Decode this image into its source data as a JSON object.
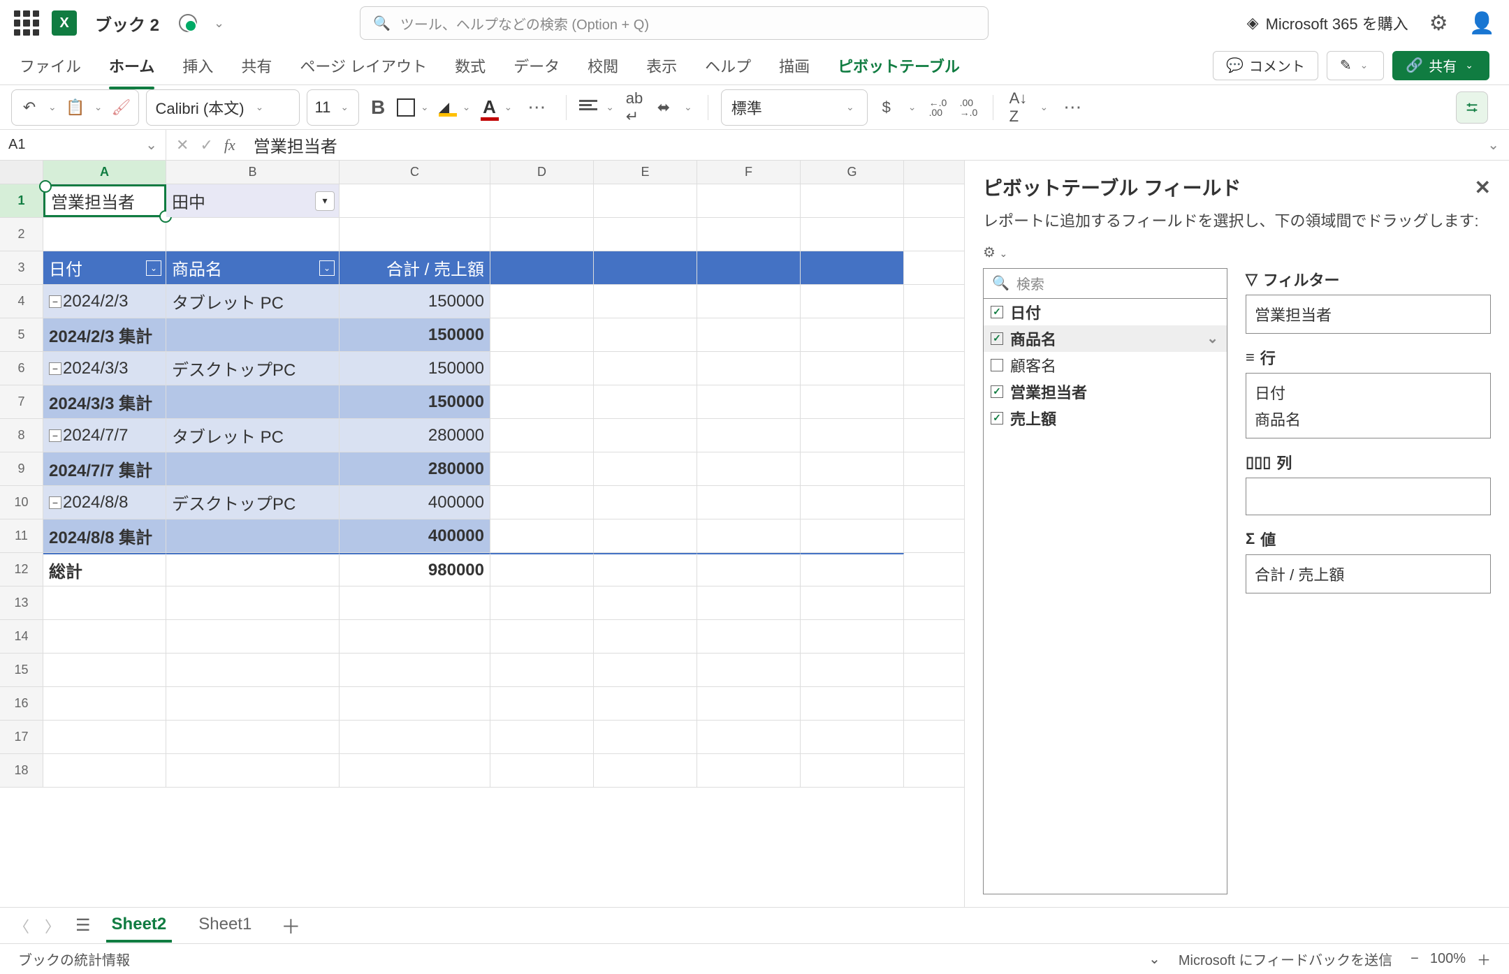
{
  "titlebar": {
    "doc_title": "ブック 2",
    "search_placeholder": "ツール、ヘルプなどの検索 (Option + Q)",
    "premium_label": "Microsoft 365 を購入"
  },
  "ribbon": {
    "tabs": [
      "ファイル",
      "ホーム",
      "挿入",
      "共有",
      "ページ レイアウト",
      "数式",
      "データ",
      "校閲",
      "表示",
      "ヘルプ",
      "描画",
      "ピボットテーブル"
    ],
    "comment_btn": "コメント",
    "share_btn": "共有"
  },
  "toolbar": {
    "font_name": "Calibri (本文)",
    "font_size": "11",
    "format_label": "標準"
  },
  "formula": {
    "name_box": "A1",
    "formula_text": "営業担当者"
  },
  "grid": {
    "columns": [
      "A",
      "B",
      "C",
      "D",
      "E",
      "F",
      "G"
    ],
    "row1": {
      "a": "営業担当者",
      "b": "田中"
    },
    "header": {
      "a": "日付",
      "b": "商品名",
      "c": "合計 / 売上額"
    },
    "rows": [
      {
        "kind": "detail",
        "a": "2024/2/3",
        "b": "タブレット PC",
        "c": "150000",
        "band": "light"
      },
      {
        "kind": "subtotal",
        "a": "2024/2/3 集計",
        "b": "",
        "c": "150000",
        "band": "dark"
      },
      {
        "kind": "detail",
        "a": "2024/3/3",
        "b": "デスクトップPC",
        "c": "150000",
        "band": "light"
      },
      {
        "kind": "subtotal",
        "a": "2024/3/3 集計",
        "b": "",
        "c": "150000",
        "band": "dark"
      },
      {
        "kind": "detail",
        "a": "2024/7/7",
        "b": "タブレット PC",
        "c": "280000",
        "band": "light"
      },
      {
        "kind": "subtotal",
        "a": "2024/7/7 集計",
        "b": "",
        "c": "280000",
        "band": "dark"
      },
      {
        "kind": "detail",
        "a": "2024/8/8",
        "b": "デスクトップPC",
        "c": "400000",
        "band": "light"
      },
      {
        "kind": "subtotal",
        "a": "2024/8/8 集計",
        "b": "",
        "c": "400000",
        "band": "dark"
      },
      {
        "kind": "grand",
        "a": "総計",
        "b": "",
        "c": "980000"
      }
    ],
    "empty_rows": [
      13,
      14,
      15,
      16,
      17,
      18
    ]
  },
  "pane": {
    "title": "ピボットテーブル フィールド",
    "description": "レポートに追加するフィールドを選択し、下の領域間でドラッグします:",
    "search_placeholder": "検索",
    "fields": [
      {
        "name": "日付",
        "checked": true,
        "bold": true,
        "hover": false
      },
      {
        "name": "商品名",
        "checked": true,
        "bold": true,
        "hover": true
      },
      {
        "name": "顧客名",
        "checked": false,
        "bold": false,
        "hover": false
      },
      {
        "name": "営業担当者",
        "checked": true,
        "bold": true,
        "hover": false
      },
      {
        "name": "売上額",
        "checked": true,
        "bold": true,
        "hover": false
      }
    ],
    "areas": {
      "filters_label": "フィルター",
      "filters": [
        "営業担当者"
      ],
      "rows_label": "行",
      "rows": [
        "日付",
        "商品名"
      ],
      "cols_label": "列",
      "cols": [],
      "values_label": "値",
      "values": [
        "合計 / 売上額"
      ]
    }
  },
  "sheets": {
    "tabs": [
      "Sheet2",
      "Sheet1"
    ],
    "active": "Sheet2"
  },
  "status": {
    "left": "ブックの統計情報",
    "feedback": "Microsoft にフィードバックを送信",
    "zoom": "100%"
  }
}
